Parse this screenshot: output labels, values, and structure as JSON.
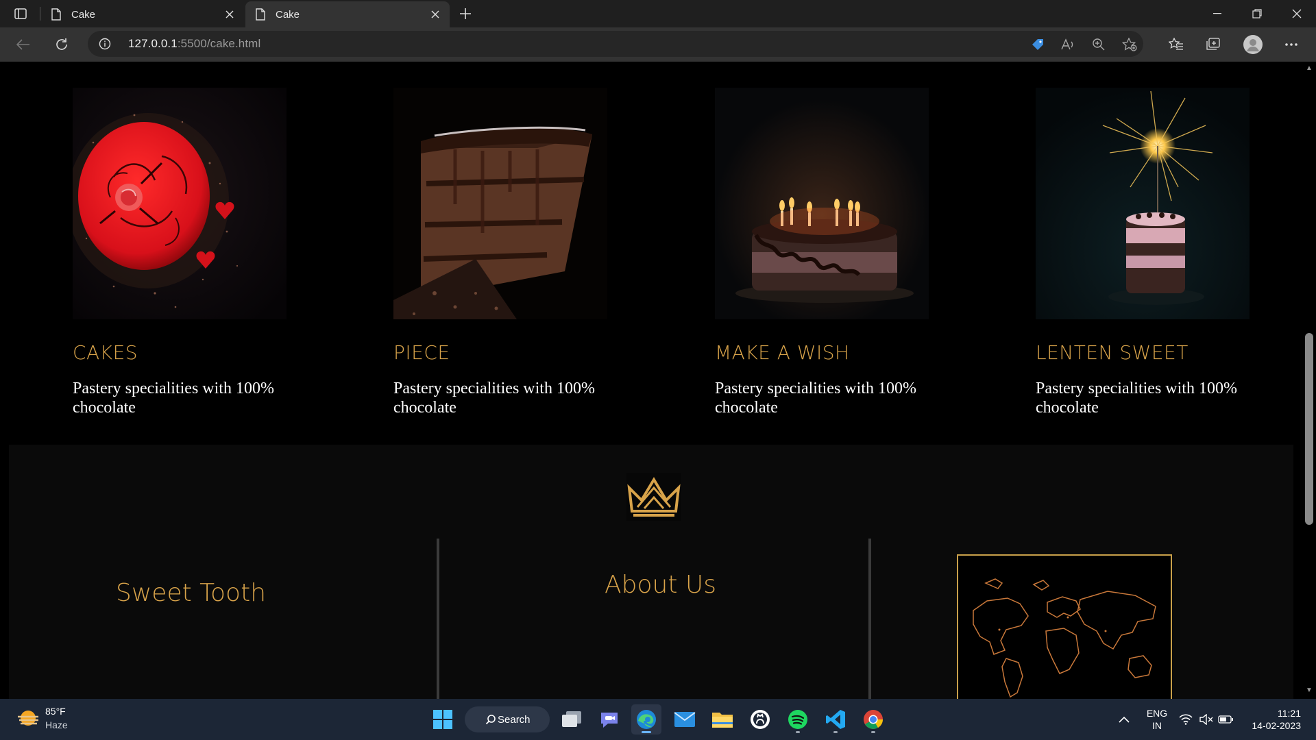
{
  "browser": {
    "tabs": [
      {
        "title": "Cake",
        "active": false
      },
      {
        "title": "Cake",
        "active": true
      }
    ],
    "url_host": "127.0.0.1",
    "url_rest": ":5500/cake.html"
  },
  "cards": [
    {
      "title": "CAKES",
      "text": "Pastery specialities with 100% chocolate",
      "image": "red-glazed-cake"
    },
    {
      "title": "PIECE",
      "text": "Pastery specialities with 100% chocolate",
      "image": "chocolate-cake-slice"
    },
    {
      "title": "MAKE A WISH",
      "text": "Pastery specialities with 100% chocolate",
      "image": "birthday-cake-candles"
    },
    {
      "title": "LENTEN SWEET",
      "text": "Pastery specialities with 100% chocolate",
      "image": "cake-with-sparkler"
    }
  ],
  "footer": {
    "col1_title": "Sweet Tooth",
    "col2_title": "About Us",
    "logo": "crown-logo",
    "map": "world-map"
  },
  "taskbar": {
    "weather_temp": "85°F",
    "weather_desc": "Haze",
    "search_label": "Search",
    "lang_1": "ENG",
    "lang_2": "IN",
    "time": "11:21",
    "date": "14-02-2023"
  },
  "colors": {
    "accent_gold": "#d8a34a",
    "page_bg": "#000000",
    "footer_bg": "#0a0a0a"
  }
}
